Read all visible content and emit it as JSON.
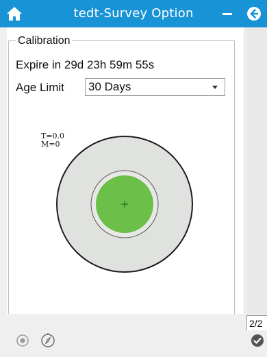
{
  "titlebar": {
    "title": "tedt-Survey Option",
    "home_icon": "home-icon",
    "minimize_icon": "minimize-icon",
    "back_icon": "back-arrow-icon",
    "color": "#1793d6"
  },
  "calibration": {
    "legend": "Calibration",
    "expire_text": "Expire in 29d 23h 59m 55s",
    "age_limit_label": "Age Limit",
    "age_limit_value": "30 Days",
    "t_value": "T=0.0",
    "m_value": "M=0",
    "gauge": {
      "outer_color": "#e0e2df",
      "inner_color": "#6cc04a"
    }
  },
  "footer": {
    "page_indicator": "2/2",
    "target_icon": "target-icon",
    "compass_icon": "compass-icon",
    "check_icon": "check-circle-icon"
  }
}
